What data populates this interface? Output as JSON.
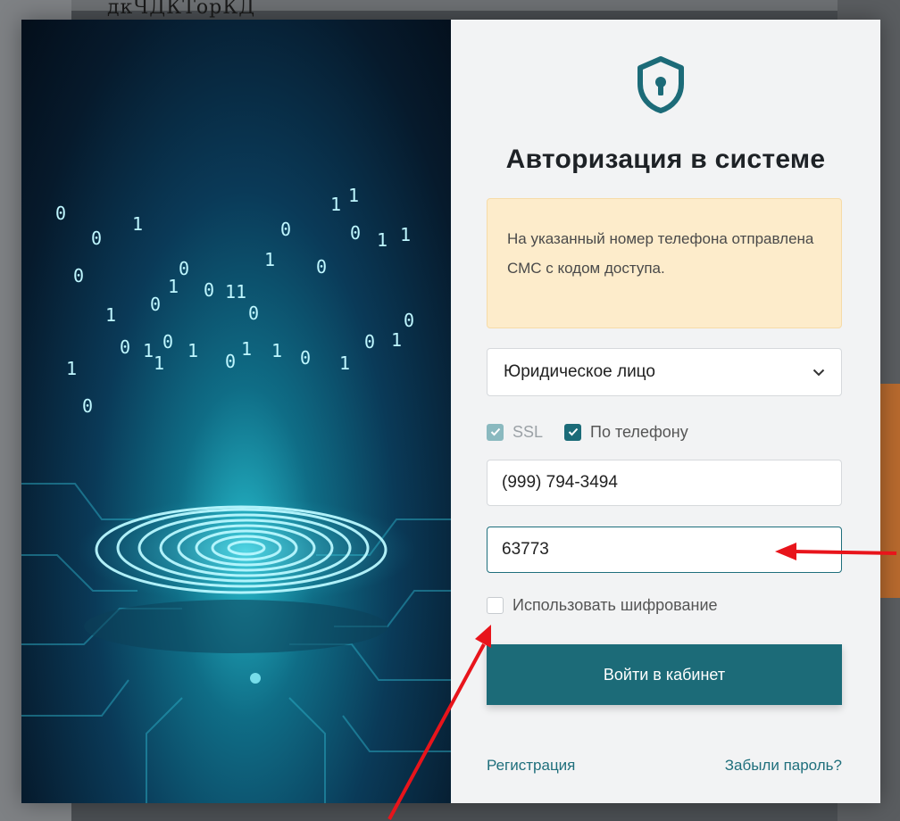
{
  "backdrop": {
    "top_text": "дкЧДКТорКД"
  },
  "modal": {
    "title": "Авторизация в системе",
    "alert": "На указанный номер телефона отправлена СМС с кодом доступа.",
    "entity_select": {
      "value": "Юридическое лицо"
    },
    "options": {
      "ssl": {
        "label": "SSL",
        "checked": true,
        "disabled": true
      },
      "by_phone": {
        "label": "По телефону",
        "checked": true
      }
    },
    "phone_field": {
      "value": "(999) 794-3494"
    },
    "code_field": {
      "value": "63773"
    },
    "encryption": {
      "label": "Использовать шифрование",
      "checked": false
    },
    "login_button": "Войти в кабинет",
    "register_link": "Регистрация",
    "forgot_link": "Забыли пароль?"
  },
  "colors": {
    "accent": "#1c6b78",
    "alert_bg": "#fdeccb",
    "annotation_arrow": "#e8141b"
  }
}
